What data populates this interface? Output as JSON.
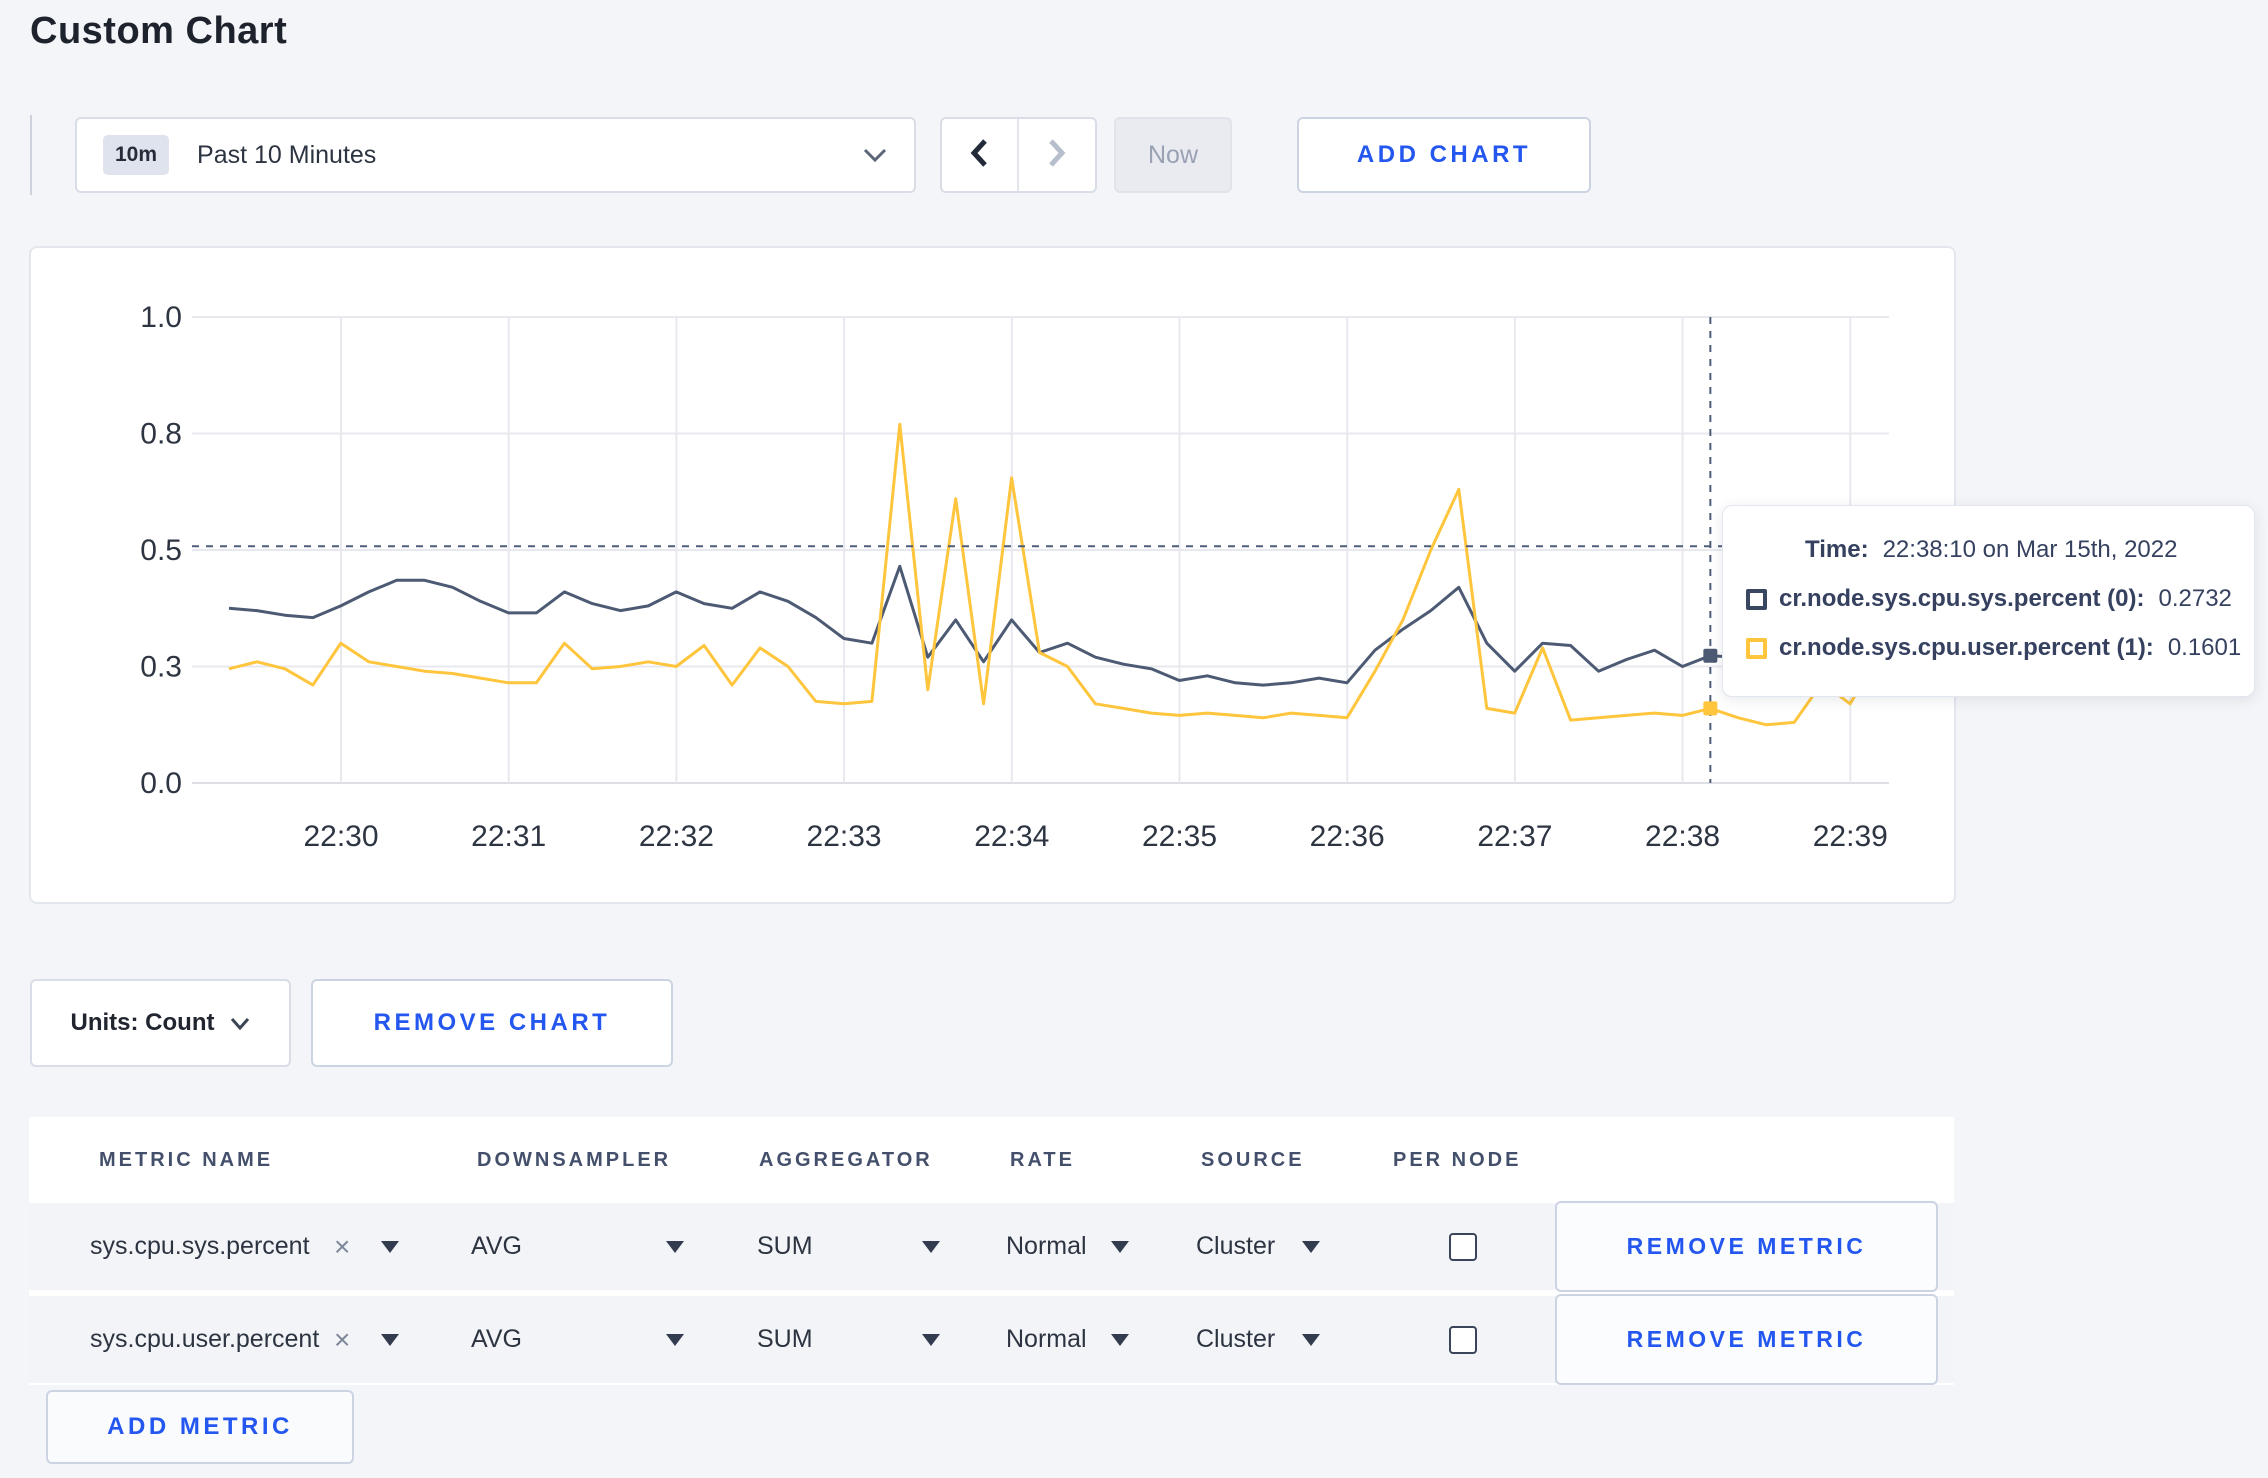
{
  "page": {
    "title": "Custom Chart"
  },
  "toolbar": {
    "range_badge": "10m",
    "range_label": "Past 10 Minutes",
    "prev_label": "previous time window",
    "next_label": "next time window",
    "now_label": "Now",
    "add_chart_label": "ADD CHART"
  },
  "chart_data": {
    "type": "line",
    "title": "",
    "xlabel": "",
    "ylabel": "",
    "ylim": [
      0,
      1
    ],
    "grid": true,
    "legend_position": "none",
    "y_tick_values": [
      0,
      0.25,
      0.5,
      0.75,
      1.0
    ],
    "y_tick_labels": [
      "0.0",
      "0.3",
      "0.5",
      "0.8",
      "1.0"
    ],
    "x_tick_labels": [
      "22:30",
      "22:31",
      "22:32",
      "22:33",
      "22:34",
      "22:35",
      "22:36",
      "22:37",
      "22:38",
      "22:39"
    ],
    "x_start": "22:29:20",
    "x_step_seconds": 10,
    "series": [
      {
        "name": "cr.node.sys.cpu.sys.percent",
        "color": "#4d5a73",
        "values": [
          0.375,
          0.37,
          0.36,
          0.355,
          0.38,
          0.41,
          0.435,
          0.435,
          0.42,
          0.39,
          0.365,
          0.365,
          0.41,
          0.385,
          0.37,
          0.38,
          0.41,
          0.385,
          0.375,
          0.41,
          0.39,
          0.355,
          0.31,
          0.3,
          0.465,
          0.27,
          0.35,
          0.26,
          0.35,
          0.28,
          0.3,
          0.27,
          0.255,
          0.245,
          0.22,
          0.23,
          0.215,
          0.21,
          0.215,
          0.225,
          0.215,
          0.285,
          0.33,
          0.37,
          0.42,
          0.3,
          0.24,
          0.3,
          0.295,
          0.24,
          0.265,
          0.285,
          0.25,
          0.2732,
          0.27,
          0.26,
          0.27,
          0.265,
          0.26,
          0.27
        ]
      },
      {
        "name": "cr.node.sys.cpu.user.percent",
        "color": "#fec53d",
        "values": [
          0.245,
          0.26,
          0.245,
          0.21,
          0.3,
          0.26,
          0.25,
          0.24,
          0.235,
          0.225,
          0.215,
          0.215,
          0.3,
          0.245,
          0.25,
          0.26,
          0.25,
          0.295,
          0.21,
          0.29,
          0.25,
          0.175,
          0.17,
          0.175,
          0.77,
          0.2,
          0.61,
          0.17,
          0.655,
          0.28,
          0.25,
          0.17,
          0.16,
          0.15,
          0.145,
          0.15,
          0.145,
          0.14,
          0.15,
          0.145,
          0.14,
          0.24,
          0.35,
          0.5,
          0.63,
          0.16,
          0.15,
          0.29,
          0.135,
          0.14,
          0.145,
          0.15,
          0.145,
          0.1601,
          0.14,
          0.125,
          0.13,
          0.215,
          0.17,
          0.27
        ]
      }
    ],
    "crosshair": {
      "index": 53,
      "hline_value": 0.508
    }
  },
  "tooltip": {
    "time_label": "Time:",
    "time_value": "22:38:10 on Mar 15th, 2022",
    "series": [
      {
        "label": "cr.node.sys.cpu.sys.percent (0):",
        "value": "0.2732",
        "color": "#394860"
      },
      {
        "label": "cr.node.sys.cpu.user.percent (1):",
        "value": "0.1601",
        "color": "#fec53d"
      }
    ]
  },
  "chart_footer": {
    "units_label": "Units: Count",
    "remove_chart_label": "REMOVE CHART"
  },
  "metrics_table": {
    "columns": [
      "METRIC NAME",
      "DOWNSAMPLER",
      "AGGREGATOR",
      "RATE",
      "SOURCE",
      "PER NODE"
    ],
    "rows": [
      {
        "metric": "sys.cpu.sys.percent",
        "downsampler": "AVG",
        "aggregator": "SUM",
        "rate": "Normal",
        "source": "Cluster",
        "per_node": false,
        "remove_label": "REMOVE METRIC"
      },
      {
        "metric": "sys.cpu.user.percent",
        "downsampler": "AVG",
        "aggregator": "SUM",
        "rate": "Normal",
        "source": "Cluster",
        "per_node": false,
        "remove_label": "REMOVE METRIC"
      }
    ],
    "add_metric_label": "ADD METRIC"
  }
}
